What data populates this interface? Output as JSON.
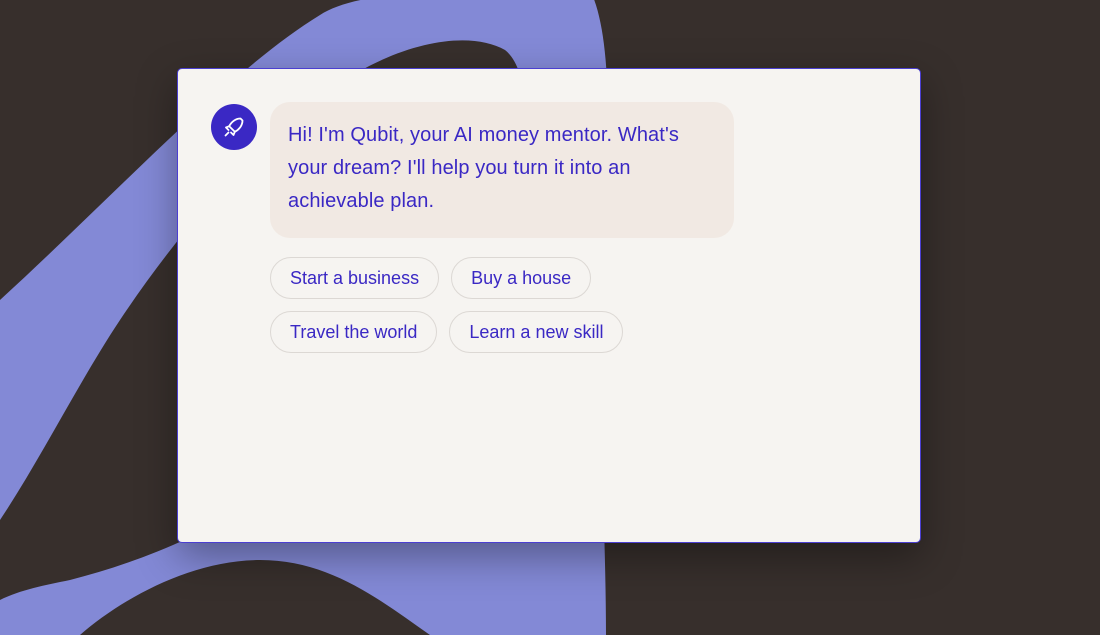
{
  "colors": {
    "background": "#372f2c",
    "accent_shape": "#8389d6",
    "window_bg": "#f6f4f1",
    "window_border": "#4b3fd1",
    "brand": "#3a28c4",
    "bubble_bg": "#f1e9e3",
    "chip_border": "#dcd8d4"
  },
  "assistant": {
    "avatar_icon": "rocket-icon",
    "message": "Hi! I'm Qubit, your AI money mentor. What's your dream? I'll help you turn it into an achievable plan."
  },
  "suggestions": [
    {
      "label": "Start a business"
    },
    {
      "label": "Buy a house"
    },
    {
      "label": "Travel the world"
    },
    {
      "label": "Learn a new skill"
    }
  ]
}
